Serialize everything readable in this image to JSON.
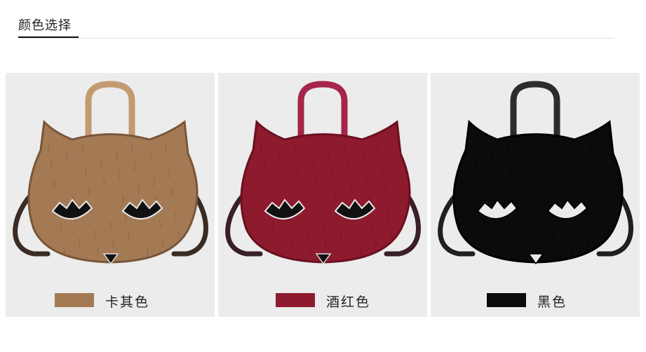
{
  "section": {
    "title": "颜色选择"
  },
  "colors": [
    {
      "label": "卡其色",
      "hex": "#a47a55",
      "handle": "#c39a70",
      "accent": "#7a5638",
      "strap": "#3a2b23"
    },
    {
      "label": "酒红色",
      "hex": "#8e1a2e",
      "handle": "#a5264a",
      "accent": "#6b1020",
      "strap": "#3a1e28"
    },
    {
      "label": "黑色",
      "hex": "#0b0b0b",
      "handle": "#2c2c2c",
      "accent": "#000000",
      "strap": "#1f1f1f"
    }
  ]
}
